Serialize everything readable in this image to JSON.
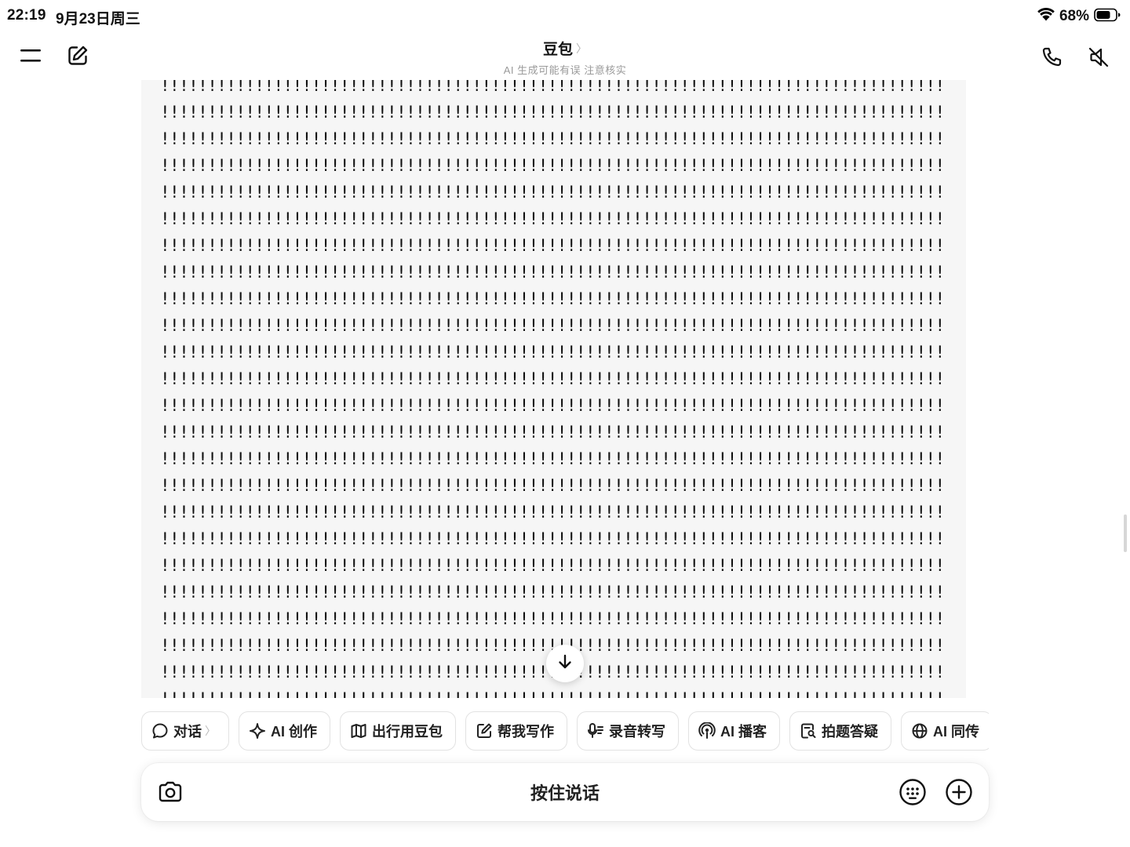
{
  "status_bar": {
    "time": "22:19",
    "date": "9月23日周三",
    "battery_percent": "68%",
    "icons": [
      "wifi-icon",
      "battery-icon"
    ]
  },
  "header": {
    "title": "豆包",
    "title_chevron": "〉",
    "subtitle": "AI 生成可能有误 注意核实",
    "left_icons": [
      "menu-icon",
      "new-chat-icon"
    ],
    "right_icons": [
      "phone-icon",
      "speaker-muted-icon"
    ]
  },
  "content": {
    "lines": [
      "!!!!!!!!!!!!!!!!!!!!!!!!!!!!!!!!!!!!!!!!!!!!!!!!!!!!!!!!!!!!!!!!!!!!!!!!!!!!!!!!!!!!!!!!",
      "!!!!!!!!!!!!!!!!!!!!!!!!!!!!!!!!!!!!!!!!!!!!!!!!!!!!!!!!!!!!!!!!!!!!!!!!!!!!!!!!!!!!!!!!",
      "!!!!!!!!!!!!!!!!!!!!!!!!!!!!!!!!!!!!!!!!!!!!!!!!!!!!!!!!!!!!!!!!!!!!!!!!!!!!!!!!!!!!!!!!",
      "!!!!!!!!!!!!!!!!!!!!!!!!!!!!!!!!!!!!!!!!!!!!!!!!!!!!!!!!!!!!!!!!!!!!!!!!!!!!!!!!!!!!!!!!",
      "!!!!!!!!!!!!!!!!!!!!!!!!!!!!!!!!!!!!!!!!!!!!!!!!!!!!!!!!!!!!!!!!!!!!!!!!!!!!!!!!!!!!!!!!",
      "!!!!!!!!!!!!!!!!!!!!!!!!!!!!!!!!!!!!!!!!!!!!!!!!!!!!!!!!!!!!!!!!!!!!!!!!!!!!!!!!!!!!!!!!",
      "!!!!!!!!!!!!!!!!!!!!!!!!!!!!!!!!!!!!!!!!!!!!!!!!!!!!!!!!!!!!!!!!!!!!!!!!!!!!!!!!!!!!!!!!",
      "!!!!!!!!!!!!!!!!!!!!!!!!!!!!!!!!!!!!!!!!!!!!!!!!!!!!!!!!!!!!!!!!!!!!!!!!!!!!!!!!!!!!!!!!",
      "!!!!!!!!!!!!!!!!!!!!!!!!!!!!!!!!!!!!!!!!!!!!!!!!!!!!!!!!!!!!!!!!!!!!!!!!!!!!!!!!!!!!!!!!",
      "!!!!!!!!!!!!!!!!!!!!!!!!!!!!!!!!!!!!!!!!!!!!!!!!!!!!!!!!!!!!!!!!!!!!!!!!!!!!!!!!!!!!!!!!",
      "!!!!!!!!!!!!!!!!!!!!!!!!!!!!!!!!!!!!!!!!!!!!!!!!!!!!!!!!!!!!!!!!!!!!!!!!!!!!!!!!!!!!!!!!",
      "!!!!!!!!!!!!!!!!!!!!!!!!!!!!!!!!!!!!!!!!!!!!!!!!!!!!!!!!!!!!!!!!!!!!!!!!!!!!!!!!!!!!!!!!",
      "!!!!!!!!!!!!!!!!!!!!!!!!!!!!!!!!!!!!!!!!!!!!!!!!!!!!!!!!!!!!!!!!!!!!!!!!!!!!!!!!!!!!!!!!",
      "!!!!!!!!!!!!!!!!!!!!!!!!!!!!!!!!!!!!!!!!!!!!!!!!!!!!!!!!!!!!!!!!!!!!!!!!!!!!!!!!!!!!!!!!",
      "!!!!!!!!!!!!!!!!!!!!!!!!!!!!!!!!!!!!!!!!!!!!!!!!!!!!!!!!!!!!!!!!!!!!!!!!!!!!!!!!!!!!!!!!",
      "!!!!!!!!!!!!!!!!!!!!!!!!!!!!!!!!!!!!!!!!!!!!!!!!!!!!!!!!!!!!!!!!!!!!!!!!!!!!!!!!!!!!!!!!",
      "!!!!!!!!!!!!!!!!!!!!!!!!!!!!!!!!!!!!!!!!!!!!!!!!!!!!!!!!!!!!!!!!!!!!!!!!!!!!!!!!!!!!!!!!",
      "!!!!!!!!!!!!!!!!!!!!!!!!!!!!!!!!!!!!!!!!!!!!!!!!!!!!!!!!!!!!!!!!!!!!!!!!!!!!!!!!!!!!!!!!",
      "!!!!!!!!!!!!!!!!!!!!!!!!!!!!!!!!!!!!!!!!!!!!!!!!!!!!!!!!!!!!!!!!!!!!!!!!!!!!!!!!!!!!!!!!",
      "!!!!!!!!!!!!!!!!!!!!!!!!!!!!!!!!!!!!!!!!!!!!!!!!!!!!!!!!!!!!!!!!!!!!!!!!!!!!!!!!!!!!!!!!",
      "!!!!!!!!!!!!!!!!!!!!!!!!!!!!!!!!!!!!!!!!!!!!!!!!!!!!!!!!!!!!!!!!!!!!!!!!!!!!!!!!!!!!!!!!",
      "!!!!!!!!!!!!!!!!!!!!!!!!!!!!!!!!!!!!!!!!!!!!!!!!!!!!!!!!!!!!!!!!!!!!!!!!!!!!!!!!!!!!!!!!",
      "!!!!!!!!!!!!!!!!!!!!!!!!!!!!!!!!!!!!!!!!!!!!!!!!!!!!!!!!!!!!!!!!!!!!!!!!!!!!!!!!!!!!!!!!",
      "!!!!!!!!!!!!!!!!!!!!!!!!!!!!!!!!!!!!!!!!!!!!!!!!!!!!!!!!!!!!!!!!!!!!!!!!!!!!!!!!!!!!!!!!"
    ],
    "scroll_down_icon": "arrow-down-icon"
  },
  "chips": [
    {
      "icon": "chat-bubble-icon",
      "label": "对话",
      "chevron": "〉"
    },
    {
      "icon": "sparkle-icon",
      "label": "AI 创作"
    },
    {
      "icon": "map-icon",
      "label": "出行用豆包"
    },
    {
      "icon": "edit-icon",
      "label": "帮我写作"
    },
    {
      "icon": "mic-transcribe-icon",
      "label": "录音转写"
    },
    {
      "icon": "podcast-icon",
      "label": "AI 播客"
    },
    {
      "icon": "doc-search-icon",
      "label": "拍题答疑"
    },
    {
      "icon": "globe-icon",
      "label": "AI 同传"
    }
  ],
  "input_bar": {
    "hold_to_talk": "按住说话",
    "icons": [
      "camera-icon",
      "keyboard-icon",
      "plus-circle-icon"
    ]
  }
}
